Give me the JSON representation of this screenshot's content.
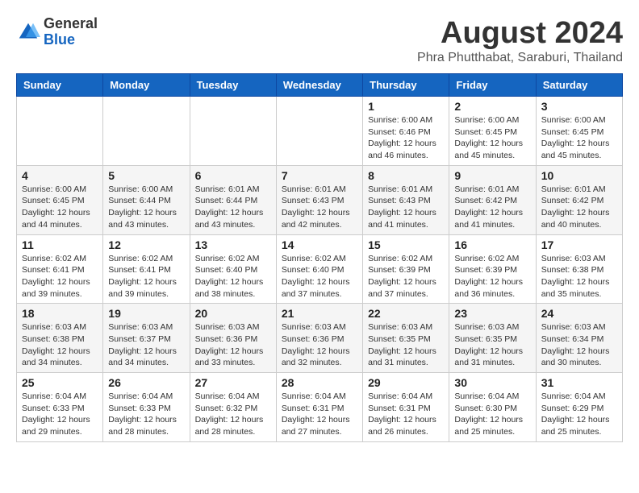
{
  "header": {
    "logo_general": "General",
    "logo_blue": "Blue",
    "main_title": "August 2024",
    "sub_title": "Phra Phutthabat, Saraburi, Thailand"
  },
  "calendar": {
    "days_of_week": [
      "Sunday",
      "Monday",
      "Tuesday",
      "Wednesday",
      "Thursday",
      "Friday",
      "Saturday"
    ],
    "weeks": [
      [
        {
          "day": "",
          "info": ""
        },
        {
          "day": "",
          "info": ""
        },
        {
          "day": "",
          "info": ""
        },
        {
          "day": "",
          "info": ""
        },
        {
          "day": "1",
          "info": "Sunrise: 6:00 AM\nSunset: 6:46 PM\nDaylight: 12 hours\nand 46 minutes."
        },
        {
          "day": "2",
          "info": "Sunrise: 6:00 AM\nSunset: 6:45 PM\nDaylight: 12 hours\nand 45 minutes."
        },
        {
          "day": "3",
          "info": "Sunrise: 6:00 AM\nSunset: 6:45 PM\nDaylight: 12 hours\nand 45 minutes."
        }
      ],
      [
        {
          "day": "4",
          "info": "Sunrise: 6:00 AM\nSunset: 6:45 PM\nDaylight: 12 hours\nand 44 minutes."
        },
        {
          "day": "5",
          "info": "Sunrise: 6:00 AM\nSunset: 6:44 PM\nDaylight: 12 hours\nand 43 minutes."
        },
        {
          "day": "6",
          "info": "Sunrise: 6:01 AM\nSunset: 6:44 PM\nDaylight: 12 hours\nand 43 minutes."
        },
        {
          "day": "7",
          "info": "Sunrise: 6:01 AM\nSunset: 6:43 PM\nDaylight: 12 hours\nand 42 minutes."
        },
        {
          "day": "8",
          "info": "Sunrise: 6:01 AM\nSunset: 6:43 PM\nDaylight: 12 hours\nand 41 minutes."
        },
        {
          "day": "9",
          "info": "Sunrise: 6:01 AM\nSunset: 6:42 PM\nDaylight: 12 hours\nand 41 minutes."
        },
        {
          "day": "10",
          "info": "Sunrise: 6:01 AM\nSunset: 6:42 PM\nDaylight: 12 hours\nand 40 minutes."
        }
      ],
      [
        {
          "day": "11",
          "info": "Sunrise: 6:02 AM\nSunset: 6:41 PM\nDaylight: 12 hours\nand 39 minutes."
        },
        {
          "day": "12",
          "info": "Sunrise: 6:02 AM\nSunset: 6:41 PM\nDaylight: 12 hours\nand 39 minutes."
        },
        {
          "day": "13",
          "info": "Sunrise: 6:02 AM\nSunset: 6:40 PM\nDaylight: 12 hours\nand 38 minutes."
        },
        {
          "day": "14",
          "info": "Sunrise: 6:02 AM\nSunset: 6:40 PM\nDaylight: 12 hours\nand 37 minutes."
        },
        {
          "day": "15",
          "info": "Sunrise: 6:02 AM\nSunset: 6:39 PM\nDaylight: 12 hours\nand 37 minutes."
        },
        {
          "day": "16",
          "info": "Sunrise: 6:02 AM\nSunset: 6:39 PM\nDaylight: 12 hours\nand 36 minutes."
        },
        {
          "day": "17",
          "info": "Sunrise: 6:03 AM\nSunset: 6:38 PM\nDaylight: 12 hours\nand 35 minutes."
        }
      ],
      [
        {
          "day": "18",
          "info": "Sunrise: 6:03 AM\nSunset: 6:38 PM\nDaylight: 12 hours\nand 34 minutes."
        },
        {
          "day": "19",
          "info": "Sunrise: 6:03 AM\nSunset: 6:37 PM\nDaylight: 12 hours\nand 34 minutes."
        },
        {
          "day": "20",
          "info": "Sunrise: 6:03 AM\nSunset: 6:36 PM\nDaylight: 12 hours\nand 33 minutes."
        },
        {
          "day": "21",
          "info": "Sunrise: 6:03 AM\nSunset: 6:36 PM\nDaylight: 12 hours\nand 32 minutes."
        },
        {
          "day": "22",
          "info": "Sunrise: 6:03 AM\nSunset: 6:35 PM\nDaylight: 12 hours\nand 31 minutes."
        },
        {
          "day": "23",
          "info": "Sunrise: 6:03 AM\nSunset: 6:35 PM\nDaylight: 12 hours\nand 31 minutes."
        },
        {
          "day": "24",
          "info": "Sunrise: 6:03 AM\nSunset: 6:34 PM\nDaylight: 12 hours\nand 30 minutes."
        }
      ],
      [
        {
          "day": "25",
          "info": "Sunrise: 6:04 AM\nSunset: 6:33 PM\nDaylight: 12 hours\nand 29 minutes."
        },
        {
          "day": "26",
          "info": "Sunrise: 6:04 AM\nSunset: 6:33 PM\nDaylight: 12 hours\nand 28 minutes."
        },
        {
          "day": "27",
          "info": "Sunrise: 6:04 AM\nSunset: 6:32 PM\nDaylight: 12 hours\nand 28 minutes."
        },
        {
          "day": "28",
          "info": "Sunrise: 6:04 AM\nSunset: 6:31 PM\nDaylight: 12 hours\nand 27 minutes."
        },
        {
          "day": "29",
          "info": "Sunrise: 6:04 AM\nSunset: 6:31 PM\nDaylight: 12 hours\nand 26 minutes."
        },
        {
          "day": "30",
          "info": "Sunrise: 6:04 AM\nSunset: 6:30 PM\nDaylight: 12 hours\nand 25 minutes."
        },
        {
          "day": "31",
          "info": "Sunrise: 6:04 AM\nSunset: 6:29 PM\nDaylight: 12 hours\nand 25 minutes."
        }
      ]
    ]
  }
}
